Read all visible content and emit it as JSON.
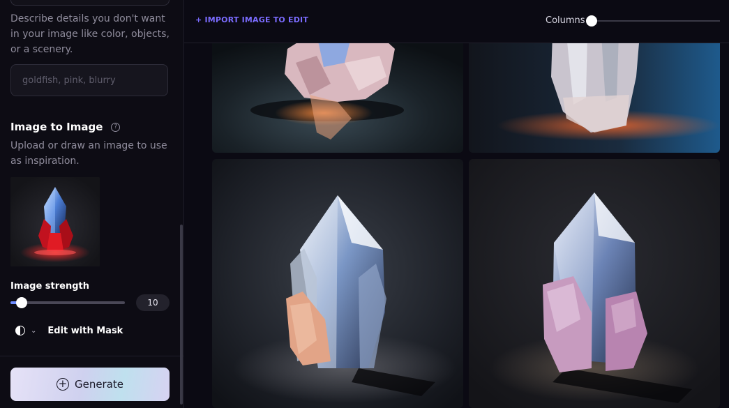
{
  "sidebar": {
    "negative_prompt": {
      "description": "Describe details you don't want in your image like color, objects, or a scenery.",
      "placeholder": "goldfish, pink, blurry"
    },
    "image_to_image": {
      "title": "Image to Image",
      "help_icon": "question-circle-icon",
      "description": "Upload or draw an image to use as inspiration."
    },
    "image_strength": {
      "label": "Image strength",
      "value": "10",
      "fraction": 0.1
    },
    "mask": {
      "icon": "half-circle-icon",
      "label": "Edit with Mask"
    },
    "generate": {
      "icon": "plus-circle-icon",
      "label": "Generate"
    }
  },
  "header": {
    "import_label": "+ IMPORT IMAGE TO EDIT",
    "columns_label": "Columns",
    "columns_fraction": 0.0
  },
  "colors": {
    "accent": "#7b6cff",
    "background": "#0b0a13",
    "slider_fill": "#6e8cff"
  }
}
